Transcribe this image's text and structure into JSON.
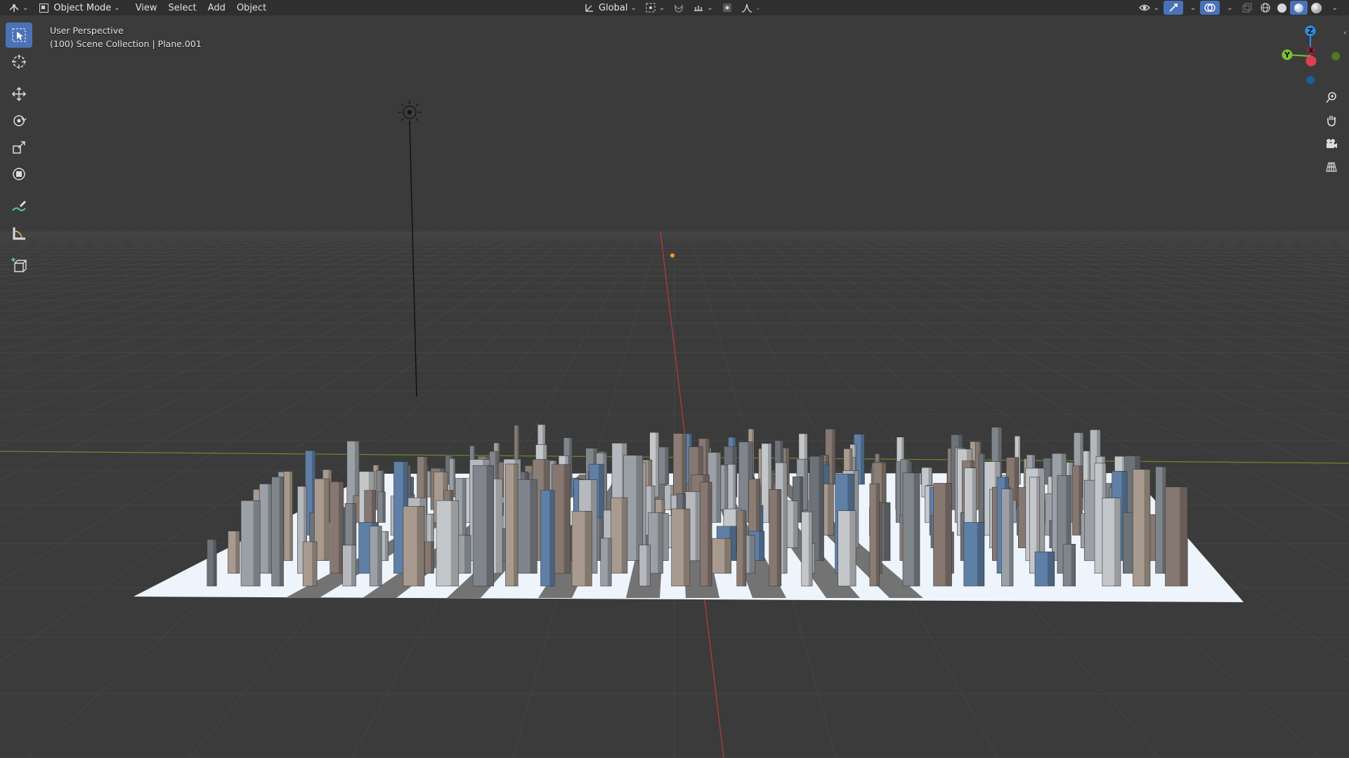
{
  "header": {
    "mode_label": "Object Mode",
    "menus": [
      "View",
      "Select",
      "Add",
      "Object"
    ],
    "transform_orientation": "Global"
  },
  "viewport": {
    "view_name": "User Perspective",
    "collection_info": "(100) Scene Collection | Plane.001"
  },
  "gizmo": {
    "z_label": "Z",
    "y_label": "Y",
    "x_label": "X",
    "colors": {
      "x": "#e23d52",
      "y": "#7bc42a",
      "z": "#2c8fe6"
    }
  },
  "tools": [
    "select-box",
    "cursor",
    "move",
    "rotate",
    "scale",
    "transform",
    "annotate",
    "measure",
    "add-cube"
  ],
  "nav_tools": [
    "zoom",
    "pan",
    "camera-view",
    "perspective-toggle"
  ],
  "colors": {
    "background": "#3b3b3b",
    "accent": "#4b72b5",
    "grid": "#474747"
  }
}
